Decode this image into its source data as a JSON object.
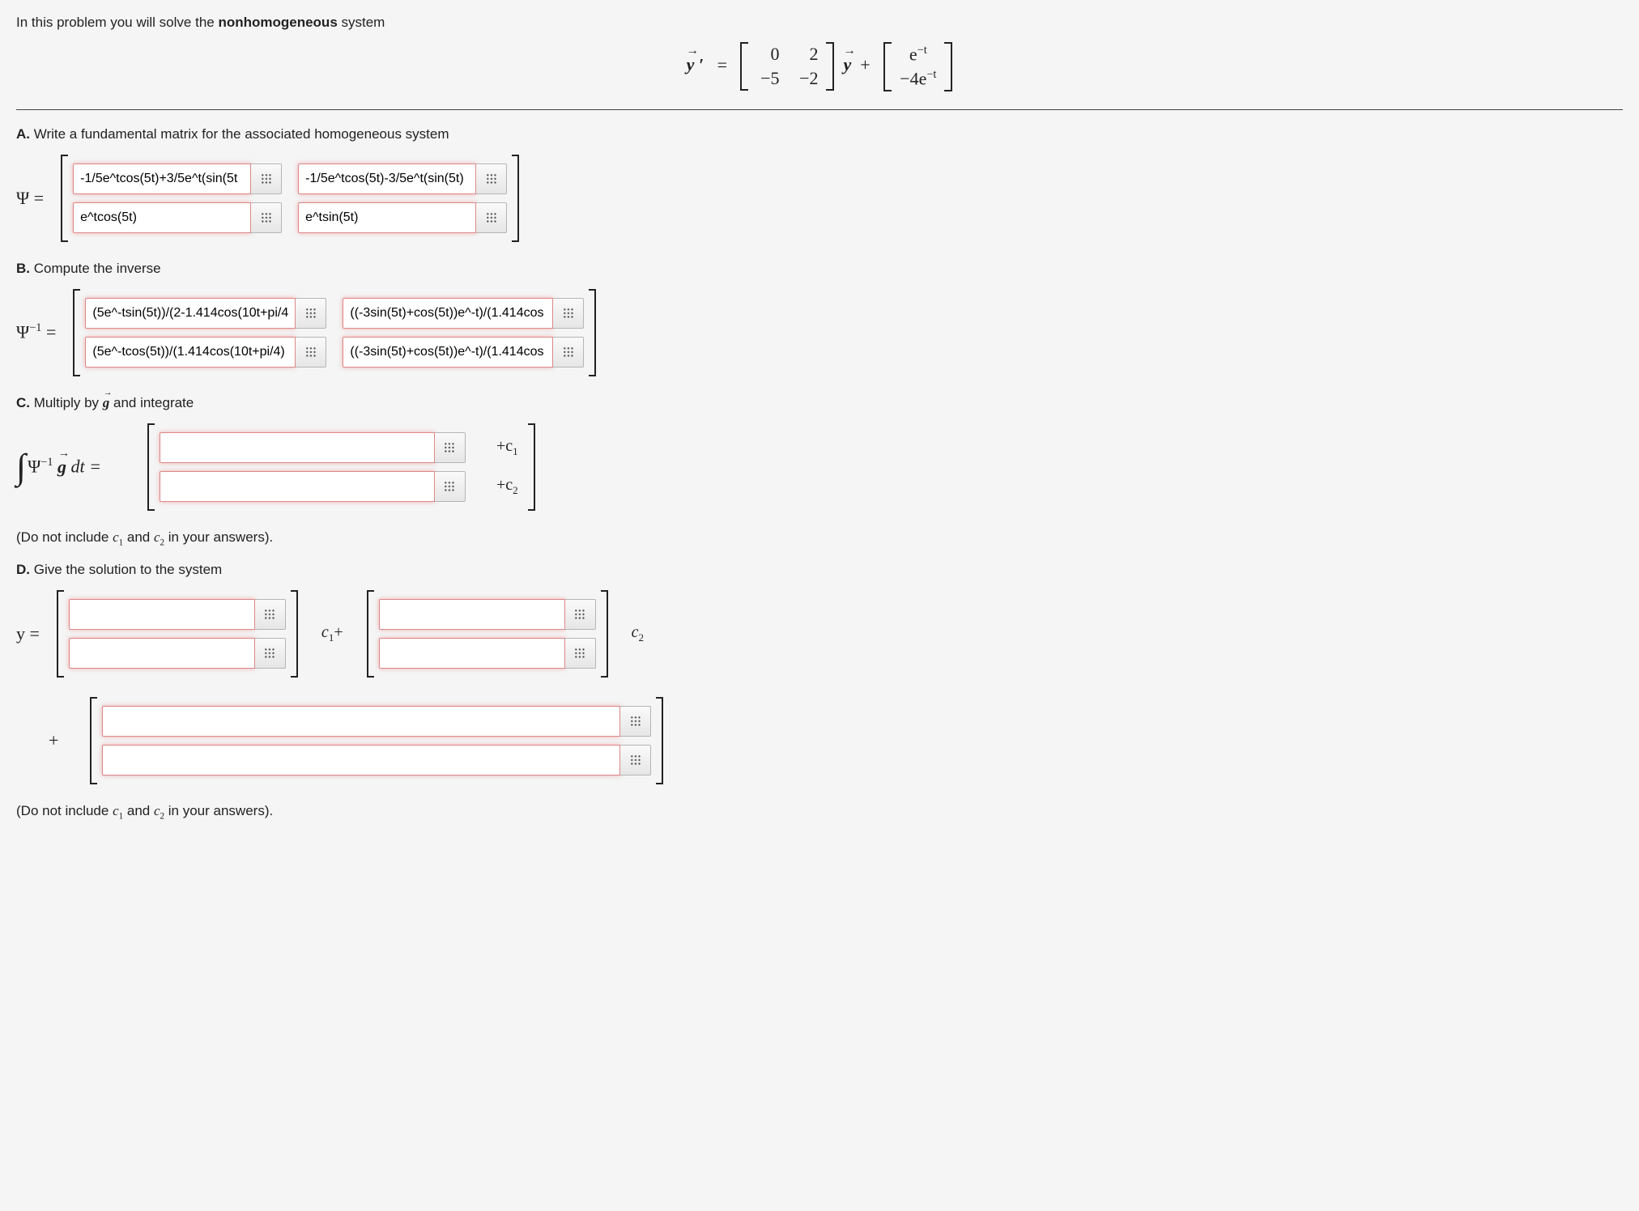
{
  "intro_prefix": "In this problem you will solve the ",
  "intro_bold": "nonhomogeneous",
  "intro_suffix": " system",
  "system_matrix": {
    "a11": "0",
    "a12": "2",
    "a21": "−5",
    "a22": "−2"
  },
  "forcing": {
    "g1": "e",
    "g1_exp": "−t",
    "g2": "−4e",
    "g2_exp": "−t"
  },
  "partA": {
    "label": "A.",
    "text": "Write a fundamental matrix for the associated homogeneous system",
    "psi_eq": "Ψ  =",
    "m": {
      "r1c1": "-1/5e^tcos(5t)+3/5e^t(sin(5t",
      "r1c2": "-1/5e^tcos(5t)-3/5e^t(sin(5t)",
      "r2c1": "e^tcos(5t)",
      "r2c2": "e^tsin(5t)"
    }
  },
  "partB": {
    "label": "B.",
    "text": "Compute the inverse",
    "lhs_pre": "Ψ",
    "lhs_sup": "−1",
    "lhs_post": "  =",
    "m": {
      "r1c1": "(5e^-tsin(5t))/(2-1.414cos(10t+pi/4",
      "r1c2": "((-3sin(5t)+cos(5t))e^-t)/(1.414cos",
      "r2c1": "(5e^-tcos(5t))/(1.414cos(10t+pi/4)",
      "r2c2": "((-3sin(5t)+cos(5t))e^-t)/(1.414cos"
    }
  },
  "partC": {
    "label": "C.",
    "text_prefix": "Multiply by ",
    "text_suffix": " and integrate",
    "lhs_psi": "Ψ",
    "lhs_sup": "−1",
    "lhs_dt": " dt  =",
    "c1": "+c",
    "c1_sub": "1",
    "c2": "+c",
    "c2_sub": "2",
    "m": {
      "r1": "",
      "r2": ""
    }
  },
  "note_prefix": "(Do not include ",
  "note_mid": " and ",
  "note_suffix": " in your answers).",
  "note_c1": "c",
  "note_c1_sub": "1",
  "note_c2": "c",
  "note_c2_sub": "2",
  "partD": {
    "label": "D.",
    "text": "Give the solution to the system",
    "lhs": "  =",
    "c1_lbl": "c",
    "c1_sub": "1",
    "c1_plus": "+",
    "c2_lbl": "c",
    "c2_sub": "2",
    "plus": "+",
    "m1": {
      "r1": "",
      "r2": ""
    },
    "m2": {
      "r1": "",
      "r2": ""
    },
    "m3": {
      "r1": "",
      "r2": ""
    }
  }
}
